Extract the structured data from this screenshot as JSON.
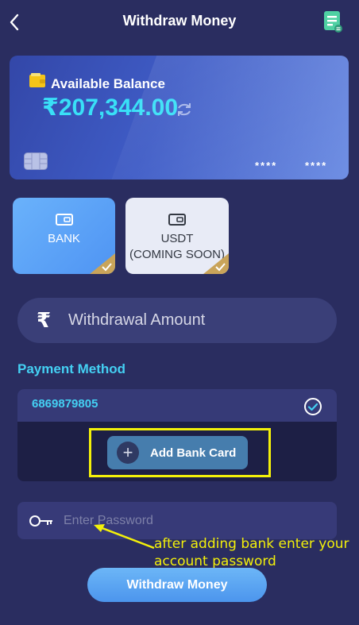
{
  "header": {
    "title": "Withdraw Money",
    "back_icon": "chevron-left-icon",
    "history_icon": "history-document-icon"
  },
  "balance_card": {
    "label": "Available Balance",
    "amount": "₹207,344.00",
    "mask_1": "****",
    "mask_2": "****",
    "accent_color": "#39e0f7"
  },
  "methods": [
    {
      "label": "BANK",
      "selected": true
    },
    {
      "label": "USDT\n(COMING SOON)",
      "selected": false
    }
  ],
  "amount_input": {
    "currency_symbol": "₹",
    "placeholder": "Withdrawal Amount"
  },
  "payment_method": {
    "heading": "Payment Method",
    "account_number": "6869879805",
    "add_button_label": "Add Bank Card"
  },
  "password_input": {
    "placeholder": "Enter Password"
  },
  "annotation": {
    "text": "after adding bank enter your account password",
    "color": "#f3f00a"
  },
  "submit_button": {
    "label": "Withdraw Money"
  }
}
